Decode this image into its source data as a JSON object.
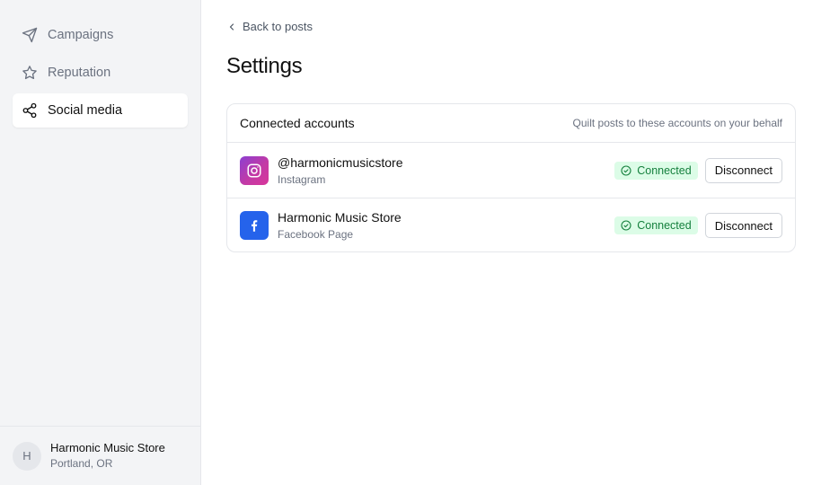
{
  "sidebar": {
    "items": [
      {
        "label": "Campaigns",
        "icon": "send-icon",
        "active": false
      },
      {
        "label": "Reputation",
        "icon": "star-icon",
        "active": false
      },
      {
        "label": "Social media",
        "icon": "share-icon",
        "active": true
      }
    ],
    "account": {
      "initial": "H",
      "name": "Harmonic Music Store",
      "location": "Portland, OR"
    }
  },
  "main": {
    "back_label": "Back to posts",
    "title": "Settings",
    "card": {
      "title": "Connected accounts",
      "subtitle": "Quilt posts to these accounts on your behalf",
      "accounts": [
        {
          "name": "@harmonicmusicstore",
          "type": "Instagram",
          "icon": "instagram-icon",
          "status": "Connected",
          "action": "Disconnect"
        },
        {
          "name": "Harmonic Music Store",
          "type": "Facebook Page",
          "icon": "facebook-icon",
          "status": "Connected",
          "action": "Disconnect"
        }
      ]
    }
  },
  "colors": {
    "sidebar_bg": "#f3f4f6",
    "status_bg": "#dcfce7",
    "status_text": "#15803d",
    "facebook": "#2563eb",
    "instagram": "#c23aa6"
  }
}
